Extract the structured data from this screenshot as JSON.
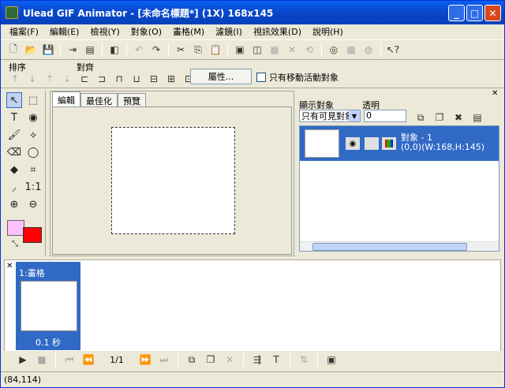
{
  "window": {
    "title": "Ulead GIF Animator - [未命名標題*] (1X) 168x145"
  },
  "menu": [
    "檔案(F)",
    "編輯(E)",
    "檢視(Y)",
    "對象(O)",
    "畫格(M)",
    "濾鏡(I)",
    "視訊效果(D)",
    "說明(H)"
  ],
  "toolbar2": {
    "order_label": "排序",
    "align_label": "對齊",
    "properties_label": "屬性...",
    "checkbox_label": "只有移動活動對象"
  },
  "tabs": [
    "編輯",
    "最佳化",
    "預覽"
  ],
  "objects_panel": {
    "show_label": "顯示對象",
    "transparency_label": "透明",
    "show_value": "只有可見對象",
    "transparency_value": "0",
    "object": {
      "name": "對象 - 1",
      "info": "(0,0)(W:168,H:145)"
    }
  },
  "frames": [
    {
      "name": "1:畫格",
      "delay": "0.1 秒"
    }
  ],
  "playbar": {
    "counter": "1/1"
  },
  "status": {
    "coords": "(84,114)"
  },
  "colors": {
    "foreground": "#ffc0ff",
    "background": "#ff0000",
    "selection": "#316ac5"
  }
}
